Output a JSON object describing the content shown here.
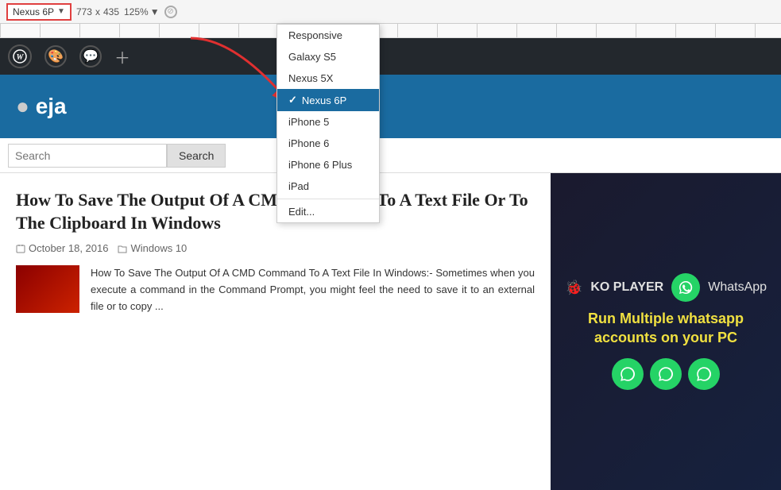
{
  "toolbar": {
    "device_label": "Nexus 6P",
    "dropdown_arrow": "▼",
    "width": "773",
    "cross": "x",
    "height": "435",
    "zoom": "125%",
    "zoom_arrow": "▼"
  },
  "dropdown": {
    "items": [
      {
        "id": "responsive",
        "label": "Responsive",
        "selected": false,
        "divider_after": false
      },
      {
        "id": "galaxy-s5",
        "label": "Galaxy S5",
        "selected": false,
        "divider_after": false
      },
      {
        "id": "nexus-5x",
        "label": "Nexus 5X",
        "selected": false,
        "divider_after": false
      },
      {
        "id": "nexus-6p",
        "label": "Nexus 6P",
        "selected": true,
        "divider_after": false
      },
      {
        "id": "iphone-5",
        "label": "iPhone 5",
        "selected": false,
        "divider_after": false
      },
      {
        "id": "iphone-6",
        "label": "iPhone 6",
        "selected": false,
        "divider_after": false
      },
      {
        "id": "iphone-6-plus",
        "label": "iPhone 6 Plus",
        "selected": false,
        "divider_after": false
      },
      {
        "id": "ipad",
        "label": "iPad",
        "selected": false,
        "divider_after": true
      },
      {
        "id": "edit",
        "label": "Edit...",
        "selected": false,
        "divider_after": false
      }
    ]
  },
  "wp_admin": {
    "logo": "W",
    "icons": [
      "🎨",
      "💬",
      "＋"
    ]
  },
  "site": {
    "title": "eja"
  },
  "search": {
    "placeholder": "Search",
    "button_label": "Search"
  },
  "article": {
    "title": "How To Save The Output Of A CMD Command To A Text File Or To The Clipboard In Windows",
    "date": "October 18, 2016",
    "category": "Windows 10",
    "excerpt": "How To Save The Output Of A CMD Command To A Text File In Windows:- Sometimes when you execute a command in the Command Prompt, you might feel the need to save it to an external file or to copy ..."
  },
  "ad": {
    "brand1": "KO PLAYER",
    "brand2": "WhatsApp",
    "headline": "Run Multiple whatsapp accounts on your PC",
    "icon_count": 3
  }
}
